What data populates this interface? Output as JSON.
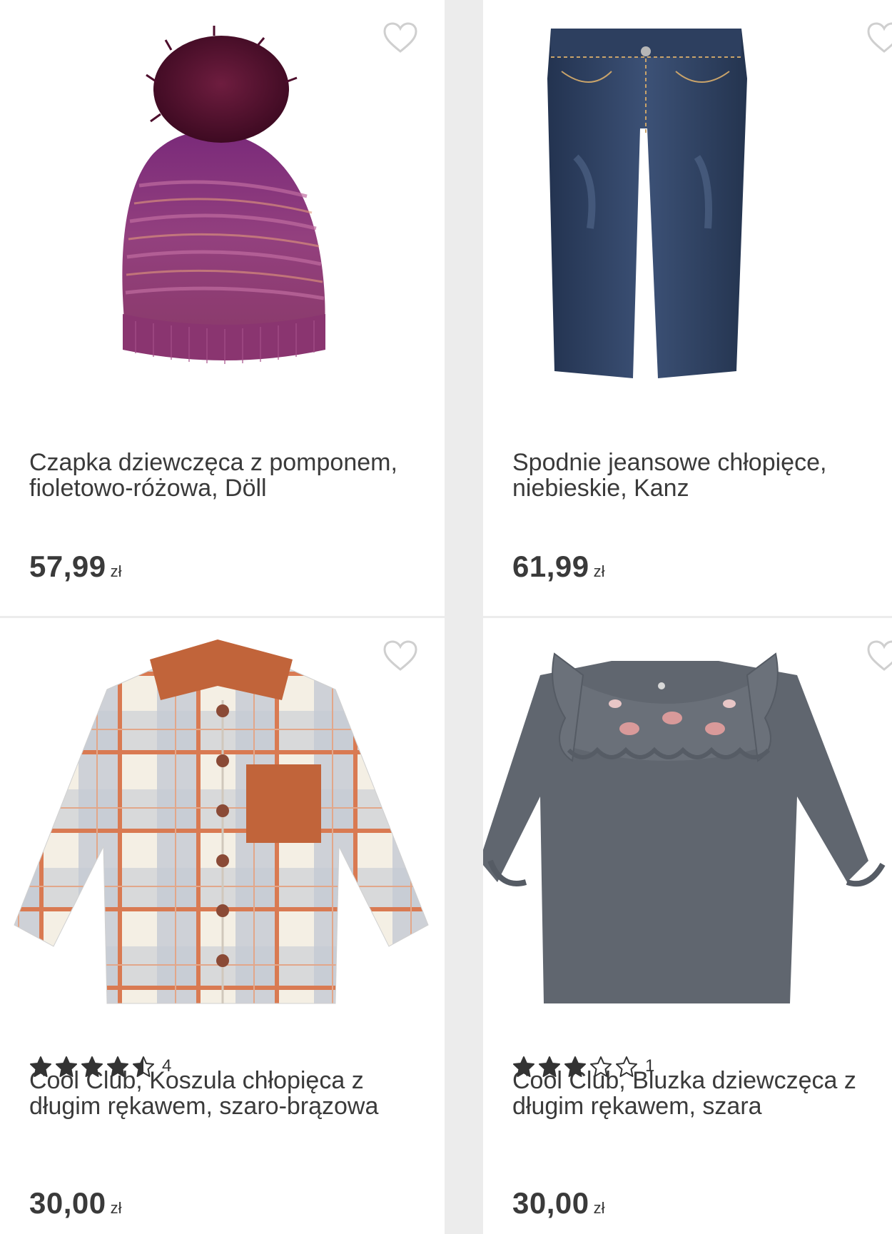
{
  "products": [
    {
      "title_line1": "Czapka dziewczęca z pomponem,",
      "title_line2": "fioletowo-różowa, Döll",
      "price": "57,99",
      "currency": "zł",
      "image_icon": "knit-hat-with-pompom-image",
      "favorite_icon": "heart-outline-icon"
    },
    {
      "title_line1": "Spodnie jeansowe chłopięce,",
      "title_line2": "niebieskie, Kanz",
      "price": "61,99",
      "currency": "zł",
      "image_icon": "jeans-image",
      "favorite_icon": "heart-outline-icon"
    },
    {
      "title_line1": "Cool Club, Koszula chłopięca z",
      "title_line2": "długim rękawem, szaro-brązowa",
      "rating": {
        "stars": 4.5,
        "max": 5,
        "count": "4"
      },
      "price": "30,00",
      "currency": "zł",
      "image_icon": "plaid-shirt-image",
      "favorite_icon": "heart-outline-icon"
    },
    {
      "title_line1": "Cool Club, Bluzka dziewczęca z",
      "title_line2": "długim rękawem, szara",
      "rating": {
        "stars": 3,
        "max": 5,
        "count": "1"
      },
      "price": "30,00",
      "currency": "zł",
      "image_icon": "grey-blouse-image",
      "favorite_icon": "heart-outline-icon"
    }
  ],
  "colors": {
    "background": "#ececec",
    "card": "#ffffff",
    "text": "#3a3a3a",
    "heart": "#cfcfcf",
    "star": "#333333"
  }
}
